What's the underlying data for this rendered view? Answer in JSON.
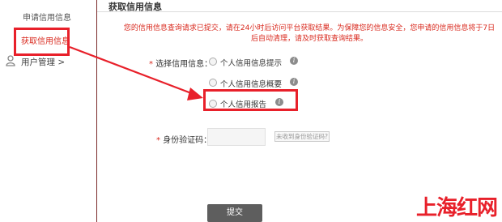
{
  "sidebar": {
    "items": [
      {
        "label": "申请信用信息"
      },
      {
        "label": "获取信用信息"
      },
      {
        "label": "用户管理 >"
      }
    ]
  },
  "main": {
    "title": "获取信用信息",
    "notice_line1": "您的信用信息查询请求已提交，请在24小时后访问平台获取结果。为保障您的信息安全，您申请的信用信息将于7日",
    "notice_line2": "后自动清理，请及时获取查询结果。",
    "form": {
      "select_label": "选择信用信息：",
      "required_mark": "*",
      "options": [
        {
          "label": "个人信用信息提示"
        },
        {
          "label": "个人信用信息概要"
        },
        {
          "label": "个人信用报告"
        }
      ],
      "id_code_label": "身份验证码：",
      "id_code_value": "",
      "code_link": "未收到身份验证码?",
      "submit_label": "提交"
    }
  },
  "icons": {
    "info": "i",
    "user": "user-icon"
  },
  "watermark": "上海红网",
  "colors": {
    "accent": "#e8202a",
    "notice": "#d9291e",
    "submit_bg": "#5e5e5e"
  }
}
